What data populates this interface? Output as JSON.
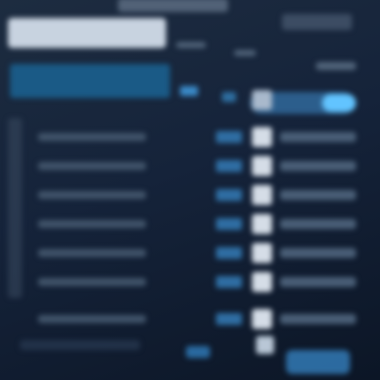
{
  "colors": {
    "background": "#15233a",
    "accent": "#62c4ff",
    "highlight_row": "#1a5a86",
    "title_bar": "#c8d3e0"
  },
  "header": {
    "title_placeholder": "",
    "right_control": ""
  },
  "table": {
    "rows": [
      {
        "name": "",
        "status": "",
        "checked": true,
        "detail": ""
      },
      {
        "name": "",
        "status": "",
        "checked": true,
        "detail": ""
      },
      {
        "name": "",
        "status": "",
        "checked": true,
        "detail": ""
      },
      {
        "name": "",
        "status": "",
        "checked": true,
        "detail": ""
      },
      {
        "name": "",
        "status": "",
        "checked": true,
        "detail": ""
      },
      {
        "name": "",
        "status": "",
        "checked": true,
        "detail": ""
      },
      {
        "name": "",
        "status": "",
        "checked": true,
        "detail": ""
      }
    ]
  },
  "toggle": {
    "state": "on"
  }
}
